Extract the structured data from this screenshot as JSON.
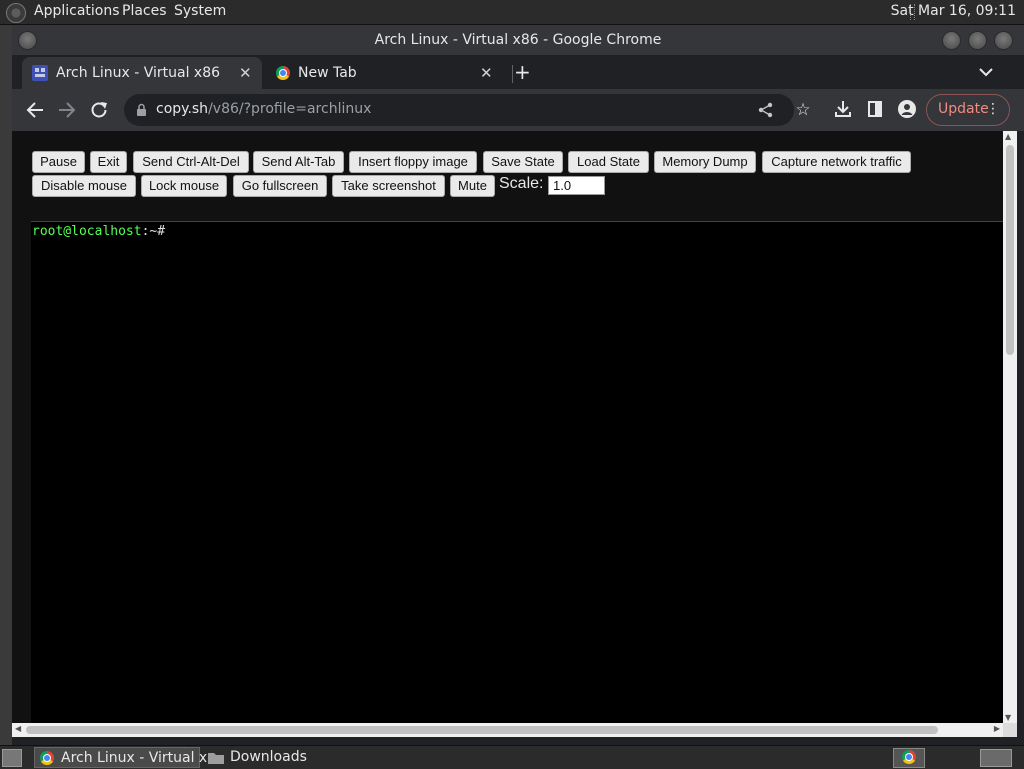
{
  "system_panel": {
    "menus": [
      "Applications",
      "Places",
      "System"
    ],
    "clock": "Sat Mar 16, 09:11"
  },
  "window": {
    "title": "Arch Linux - Virtual x86 - Google Chrome"
  },
  "tabs": [
    {
      "label": "Arch Linux - Virtual x86",
      "active": true,
      "icon": "v86-favicon-icon"
    },
    {
      "label": "New Tab",
      "active": false,
      "icon": "chrome-favicon-icon"
    }
  ],
  "toolbar": {
    "url_host": "copy.sh",
    "url_path": "/v86/?profile=archlinux",
    "update_label": "Update"
  },
  "v86": {
    "buttons_row1": [
      "Pause",
      "Exit",
      "Send Ctrl-Alt-Del",
      "Send Alt-Tab",
      "Insert floppy image",
      "Save State",
      "Load State",
      "Memory Dump",
      "Capture network traffic"
    ],
    "buttons_row2": [
      "Disable mouse",
      "Lock mouse",
      "Go fullscreen",
      "Take screenshot",
      "Mute"
    ],
    "scale_label": "Scale:",
    "scale_value": "1.0"
  },
  "terminal": {
    "user_host": "root@localhost",
    "rest": ":~# "
  },
  "taskbar": {
    "items": [
      {
        "label": "Arch Linux - Virtual x...",
        "icon": "chrome-icon"
      },
      {
        "label": "Downloads",
        "icon": "folder-icon"
      }
    ]
  },
  "colors": {
    "prompt_green": "#55ff55",
    "update_accent": "#f28b82"
  }
}
